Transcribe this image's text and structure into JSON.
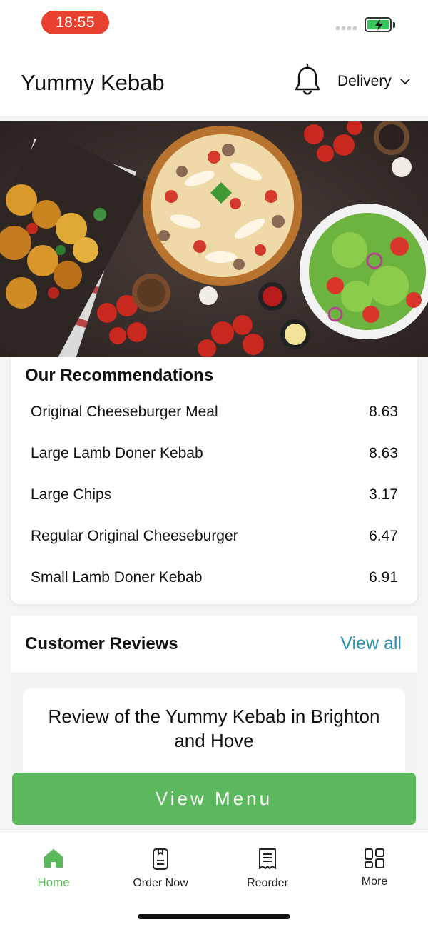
{
  "status": {
    "time": "18:55"
  },
  "header": {
    "title": "Yummy Kebab",
    "mode_label": "Delivery"
  },
  "recommendations": {
    "title": "Our Recommendations",
    "items": [
      {
        "name": "Original Cheeseburger Meal",
        "price": "8.63"
      },
      {
        "name": "Large Lamb Doner Kebab",
        "price": "8.63"
      },
      {
        "name": "Large Chips",
        "price": "3.17"
      },
      {
        "name": "Regular Original Cheeseburger",
        "price": "6.47"
      },
      {
        "name": "Small Lamb Doner Kebab",
        "price": "6.91"
      }
    ]
  },
  "reviews": {
    "title": "Customer Reviews",
    "view_all": "View all",
    "card_title": "Review of the Yummy Kebab in Brighton and Hove"
  },
  "cta": {
    "label": "View Menu"
  },
  "tabs": [
    {
      "label": "Home",
      "icon": "home-icon"
    },
    {
      "label": "Order Now",
      "icon": "order-icon"
    },
    {
      "label": "Reorder",
      "icon": "receipt-icon"
    },
    {
      "label": "More",
      "icon": "grid-icon"
    }
  ],
  "colors": {
    "accent": "#5cb85c",
    "link": "#2b8fb3",
    "status_pill": "#e8412f"
  }
}
